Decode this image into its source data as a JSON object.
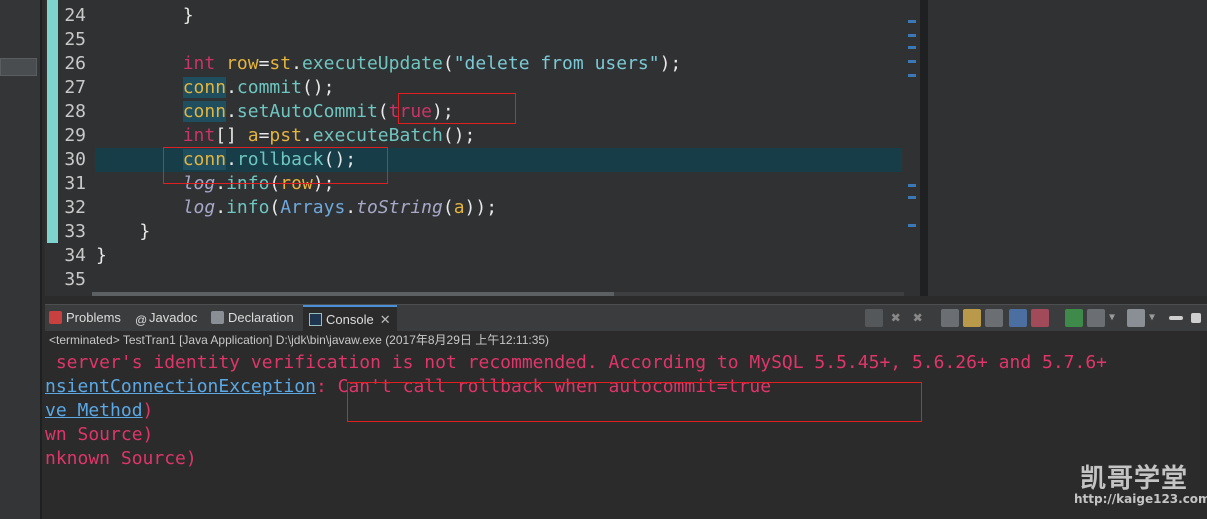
{
  "editor": {
    "lines": [
      {
        "num": "24",
        "indent": "        ",
        "tokens": [
          {
            "t": "}",
            "c": "ps"
          }
        ]
      },
      {
        "num": "25",
        "indent": "",
        "tokens": []
      },
      {
        "num": "26",
        "indent": "        ",
        "tokens": [
          {
            "t": "int",
            "c": "kw"
          },
          {
            "t": " ",
            "c": "ps"
          },
          {
            "t": "row",
            "c": "vr"
          },
          {
            "t": "=",
            "c": "ps"
          },
          {
            "t": "st",
            "c": "vr"
          },
          {
            "t": ".",
            "c": "ps"
          },
          {
            "t": "executeUpdate",
            "c": "md"
          },
          {
            "t": "(",
            "c": "ps"
          },
          {
            "t": "\"delete from users\"",
            "c": "st"
          },
          {
            "t": ");",
            "c": "ps"
          }
        ]
      },
      {
        "num": "27",
        "indent": "        ",
        "tokens": [
          {
            "t": "conn",
            "c": "vr connbg"
          },
          {
            "t": ".",
            "c": "ps"
          },
          {
            "t": "commit",
            "c": "md"
          },
          {
            "t": "();",
            "c": "ps"
          }
        ]
      },
      {
        "num": "28",
        "indent": "        ",
        "tokens": [
          {
            "t": "conn",
            "c": "vr connbg"
          },
          {
            "t": ".",
            "c": "ps"
          },
          {
            "t": "setAutoCommit",
            "c": "md"
          },
          {
            "t": "(",
            "c": "ps"
          },
          {
            "t": "true",
            "c": "kw"
          },
          {
            "t": ");",
            "c": "ps"
          }
        ]
      },
      {
        "num": "29",
        "indent": "        ",
        "tokens": [
          {
            "t": "int",
            "c": "kw"
          },
          {
            "t": "[] ",
            "c": "ps"
          },
          {
            "t": "a",
            "c": "vr"
          },
          {
            "t": "=",
            "c": "ps"
          },
          {
            "t": "pst",
            "c": "vr"
          },
          {
            "t": ".",
            "c": "ps"
          },
          {
            "t": "executeBatch",
            "c": "md"
          },
          {
            "t": "();",
            "c": "ps"
          }
        ]
      },
      {
        "num": "30",
        "indent": "        ",
        "tokens": [
          {
            "t": "conn",
            "c": "vr connbg"
          },
          {
            "t": ".",
            "c": "ps"
          },
          {
            "t": "rollback",
            "c": "md"
          },
          {
            "t": "();",
            "c": "ps"
          }
        ]
      },
      {
        "num": "31",
        "indent": "        ",
        "tokens": [
          {
            "t": "log",
            "c": "it"
          },
          {
            "t": ".",
            "c": "ps"
          },
          {
            "t": "info",
            "c": "md"
          },
          {
            "t": "(",
            "c": "ps"
          },
          {
            "t": "row",
            "c": "vr"
          },
          {
            "t": ");",
            "c": "ps"
          }
        ]
      },
      {
        "num": "32",
        "indent": "        ",
        "tokens": [
          {
            "t": "log",
            "c": "it"
          },
          {
            "t": ".",
            "c": "ps"
          },
          {
            "t": "info",
            "c": "md"
          },
          {
            "t": "(",
            "c": "ps"
          },
          {
            "t": "Arrays",
            "c": "ct"
          },
          {
            "t": ".",
            "c": "ps"
          },
          {
            "t": "toString",
            "c": "it"
          },
          {
            "t": "(",
            "c": "ps"
          },
          {
            "t": "a",
            "c": "vr"
          },
          {
            "t": "));",
            "c": "ps"
          }
        ]
      },
      {
        "num": "33",
        "indent": "    ",
        "tokens": [
          {
            "t": "}",
            "c": "ps"
          }
        ]
      },
      {
        "num": "34",
        "indent": "",
        "tokens": [
          {
            "t": "}",
            "c": "ps"
          }
        ]
      },
      {
        "num": "35",
        "indent": "",
        "tokens": []
      }
    ]
  },
  "tabs": {
    "problems": "Problems",
    "javadoc": "Javadoc",
    "declaration": "Declaration",
    "console": "Console"
  },
  "console": {
    "status": "<terminated> TestTran1 [Java Application] D:\\jdk\\bin\\javaw.exe (2017年8月29日 上午12:11:35)",
    "line1": " server's identity verification is not recommended. According to MySQL 5.5.45+, 5.6.26+ and 5.7.6+",
    "line2_link": "nsientConnectionException",
    "line2_rest": ": Can't call rollback when autocommit=true",
    "line3_link": "ve Method",
    "line3_rest": ")",
    "line4": "wn Source)",
    "line5": "nknown Source)"
  },
  "watermark": {
    "title": "凯哥学堂",
    "url": "http://kaige123.com"
  },
  "colors": {
    "error": "#e0356a",
    "link": "#5aa8e6",
    "highlight": "#173d49",
    "redbox": "#e02020"
  }
}
